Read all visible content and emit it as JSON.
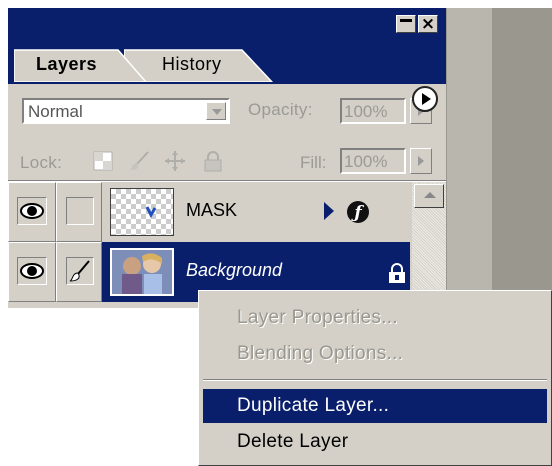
{
  "panel": {
    "tabs": [
      "Layers",
      "History"
    ],
    "active_tab": "Layers"
  },
  "blend_mode": {
    "value": "Normal"
  },
  "opacity": {
    "label": "Opacity:",
    "value": "100%"
  },
  "lock": {
    "label": "Lock:"
  },
  "fill": {
    "label": "Fill:",
    "value": "100%"
  },
  "layers": [
    {
      "name": "MASK",
      "selected": false,
      "visible": true
    },
    {
      "name": "Background",
      "selected": true,
      "visible": true,
      "locked": true
    }
  ],
  "context_menu": {
    "items": [
      {
        "label": "Layer Properties...",
        "enabled": false
      },
      {
        "label": "Blending Options...",
        "enabled": false
      },
      {
        "label": "Duplicate Layer...",
        "enabled": true,
        "highlighted": true
      },
      {
        "label": "Delete Layer",
        "enabled": true
      }
    ]
  },
  "colors": {
    "titlebar": "#0a1f6b",
    "panel": "#d4d0c8",
    "selection": "#0a1f6b"
  }
}
